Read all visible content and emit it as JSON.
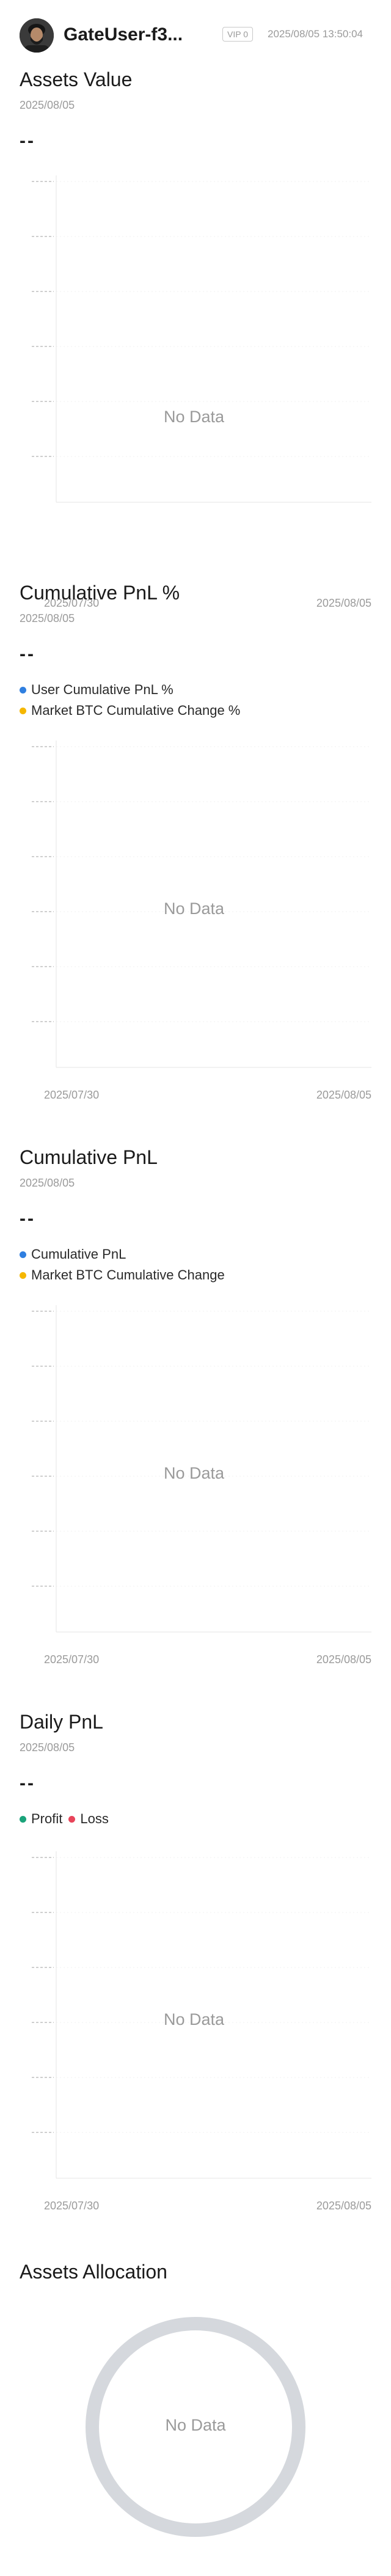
{
  "header": {
    "username": "GateUser-f3...",
    "vip": "VIP 0",
    "timestamp": "2025/08/05 13:50:04"
  },
  "sections": {
    "assets_value": {
      "title": "Assets Value",
      "date": "2025/08/05",
      "value": "--",
      "no_data": "No Data",
      "x_start": "2025/07/30",
      "x_end": "2025/08/05"
    },
    "cum_pnl_pct": {
      "title": "Cumulative PnL %",
      "date": "2025/08/05",
      "value": "--",
      "legend": [
        {
          "label": "User Cumulative PnL %",
          "color": "#2f7fe0"
        },
        {
          "label": "Market BTC Cumulative Change %",
          "color": "#f5b700"
        }
      ],
      "no_data": "No Data",
      "x_start": "2025/07/30",
      "x_end": "2025/08/05"
    },
    "cum_pnl": {
      "title": "Cumulative PnL",
      "date": "2025/08/05",
      "value": "--",
      "legend": [
        {
          "label": "Cumulative PnL",
          "color": "#2f7fe0"
        },
        {
          "label": "Market BTC Cumulative Change",
          "color": "#f5b700"
        }
      ],
      "no_data": "No Data",
      "x_start": "2025/07/30",
      "x_end": "2025/08/05"
    },
    "daily_pnl": {
      "title": "Daily PnL",
      "date": "2025/08/05",
      "value": "--",
      "legend": [
        {
          "label": "Profit",
          "color": "#1aa37a"
        },
        {
          "label": "Loss",
          "color": "#e8445a"
        }
      ],
      "no_data": "No Data",
      "x_start": "2025/07/30",
      "x_end": "2025/08/05"
    },
    "allocation": {
      "title": "Assets Allocation",
      "no_data": "No Data"
    }
  },
  "chart_data": [
    {
      "type": "line",
      "title": "Assets Value",
      "series": [],
      "x": [
        "2025/07/30",
        "2025/08/05"
      ],
      "grid": true
    },
    {
      "type": "line",
      "title": "Cumulative PnL %",
      "series": [
        {
          "name": "User Cumulative PnL %",
          "values": []
        },
        {
          "name": "Market BTC Cumulative Change %",
          "values": []
        }
      ],
      "x": [
        "2025/07/30",
        "2025/08/05"
      ],
      "grid": true
    },
    {
      "type": "line",
      "title": "Cumulative PnL",
      "series": [
        {
          "name": "Cumulative PnL",
          "values": []
        },
        {
          "name": "Market BTC Cumulative Change",
          "values": []
        }
      ],
      "x": [
        "2025/07/30",
        "2025/08/05"
      ],
      "grid": true
    },
    {
      "type": "bar",
      "title": "Daily PnL",
      "series": [
        {
          "name": "Profit",
          "values": []
        },
        {
          "name": "Loss",
          "values": []
        }
      ],
      "x": [
        "2025/07/30",
        "2025/08/05"
      ],
      "grid": true
    },
    {
      "type": "pie",
      "title": "Assets Allocation",
      "values": []
    }
  ],
  "colors": {
    "grid": "#e6e6e6",
    "muted_text": "#9a9a9a",
    "donut_ring": "#d5d8dd"
  }
}
